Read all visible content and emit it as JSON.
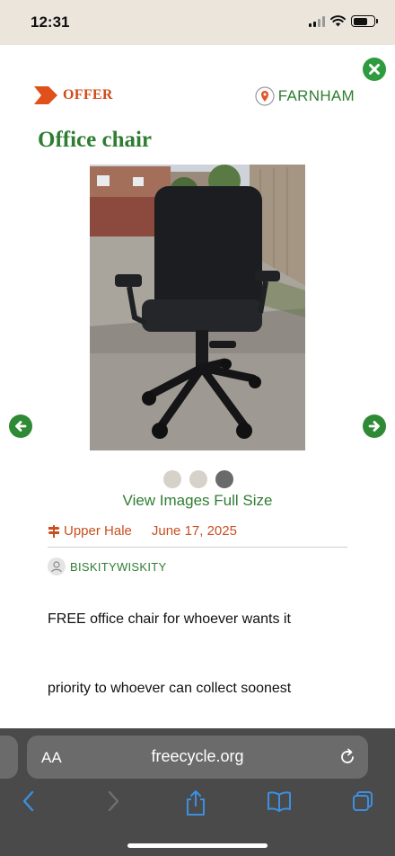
{
  "status_bar": {
    "time": "12:31"
  },
  "listing": {
    "type_label": "OFFER",
    "location_label": "FARNHAM",
    "title": "Office chair",
    "image_count": 3,
    "active_image_index": 2,
    "view_full_size_label": "View Images Full Size",
    "area": "Upper Hale",
    "date": "June 17, 2025",
    "username": "BISKITYWISKITY",
    "description": [
      "FREE office chair for whoever wants it",
      "priority to whoever can collect soonest"
    ]
  },
  "browser": {
    "text_size_label": "AA",
    "url": "freecycle.org"
  },
  "icons": {
    "close": "close-icon",
    "offer": "offer-arrow-icon",
    "location": "map-pin-icon",
    "prev": "arrow-left-icon",
    "next": "arrow-right-icon",
    "area": "signpost-icon",
    "avatar": "user-avatar-icon",
    "reload": "reload-icon",
    "back": "back-icon",
    "forward": "forward-icon",
    "share": "share-icon",
    "bookmarks": "bookmarks-icon",
    "tabs": "tabs-icon"
  },
  "colors": {
    "brand_green": "#2f7d32",
    "accent_orange": "#d04a17",
    "status_bar_bg": "#ece5dc",
    "browser_bg": "#4a4a4a"
  }
}
